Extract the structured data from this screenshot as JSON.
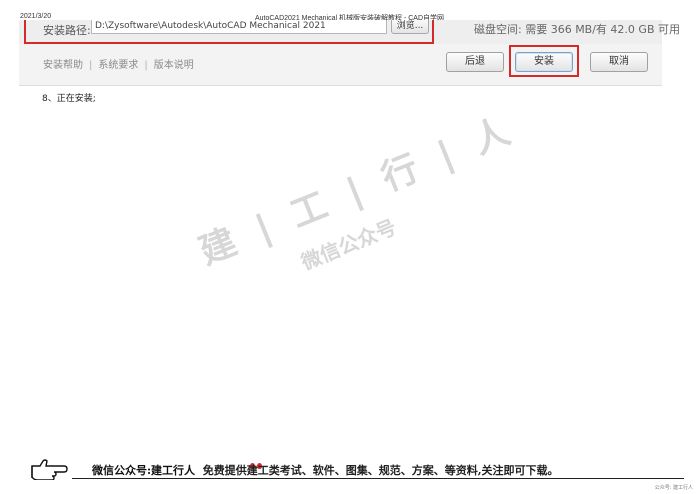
{
  "header": {
    "date": "2021/3/20",
    "doc_title": "AutoCAD2021 Mechanical 机械版安装破解教程 - CAD自学网"
  },
  "installer": {
    "path_label": "安装路径:",
    "path_value": "D:\\Zysoftware\\Autodesk\\AutoCAD Mechanical 2021",
    "browse_label": "浏览...",
    "disk_space": "磁盘空间: 需要 366 MB/有 42.0 GB 可用",
    "help_links": [
      "安装帮助",
      "系统要求",
      "版本说明"
    ],
    "buttons": {
      "back": "后退",
      "install": "安装",
      "cancel": "取消"
    },
    "highlight_color": "#d42a2a"
  },
  "step": {
    "text": "8、正在安装;"
  },
  "watermark": {
    "name": "建 | 工 | 行 | 人",
    "subtitle": "微信公众号"
  },
  "footer": {
    "text_part1": "微信公众号:建工行人",
    "text_part2": "免费提供建工类考试、软件、图集、规范、方案、等资料,关注即可下载。",
    "hand_icon": "pointing-hand-icon"
  },
  "corner_tag": "公众号: 建工行人"
}
